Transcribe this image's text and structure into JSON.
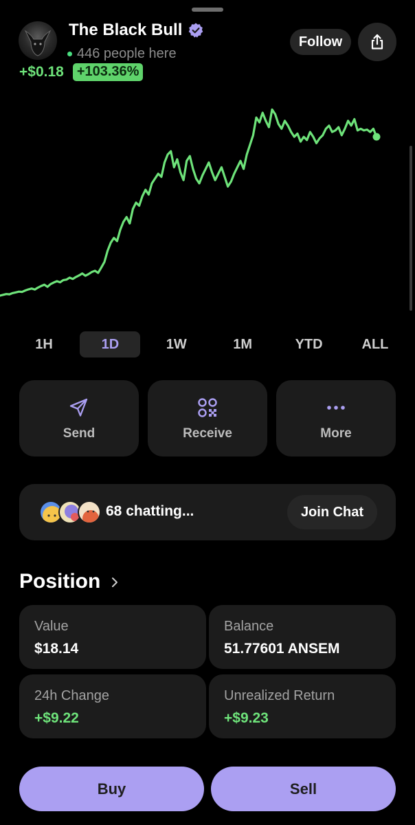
{
  "header": {
    "token_name": "The Black Bull",
    "people_here": "446 people here",
    "change_abs": "+$0.18",
    "change_pct": "+103.36%",
    "follow_label": "Follow"
  },
  "chart_data": {
    "type": "line",
    "x": [
      0,
      1,
      2,
      3,
      4,
      5,
      6,
      7,
      8,
      9,
      10,
      11,
      12,
      13,
      14,
      15,
      16,
      17,
      18,
      19,
      20,
      21,
      22,
      23,
      24,
      25,
      26,
      27,
      28,
      29,
      30,
      31,
      32,
      33,
      34,
      35,
      36,
      37,
      38,
      39,
      40,
      41,
      42,
      43,
      44,
      45,
      46,
      47,
      48,
      49,
      50,
      51,
      52,
      53,
      54,
      55,
      56,
      57,
      58,
      59,
      60,
      61,
      62,
      63,
      64,
      65,
      66,
      67,
      68,
      69,
      70,
      71,
      72,
      73,
      74,
      75,
      76,
      77,
      78,
      79,
      80,
      81,
      82,
      83,
      84,
      85,
      86,
      87,
      88,
      89,
      90,
      91,
      92,
      93,
      94,
      95,
      96,
      97,
      98,
      99,
      100,
      101,
      102,
      103,
      104,
      105,
      106,
      107,
      108,
      109,
      110,
      111,
      112,
      113,
      114,
      115,
      116,
      117,
      118,
      119
    ],
    "values": [
      0.0,
      0.5,
      1.0,
      0.8,
      1.6,
      2.0,
      2.5,
      2.3,
      3.2,
      3.9,
      4.4,
      3.8,
      5.0,
      6.0,
      6.8,
      5.5,
      7.2,
      8.2,
      9.0,
      8.3,
      9.7,
      10.0,
      11.2,
      10.4,
      11.6,
      12.6,
      13.8,
      12.4,
      13.4,
      14.7,
      15.5,
      14.2,
      17.5,
      21.0,
      28.0,
      33.0,
      36.0,
      34.0,
      41.0,
      46.0,
      49.0,
      45.0,
      54.0,
      58.0,
      56.0,
      62.0,
      66.0,
      63.0,
      70.0,
      73.0,
      76.0,
      74.0,
      83.0,
      88.0,
      90.0,
      80.0,
      85.0,
      77.0,
      72.0,
      84.0,
      87.0,
      79.0,
      73.0,
      70.0,
      75.0,
      79.0,
      83.0,
      77.0,
      72.0,
      76.0,
      80.0,
      74.0,
      68.0,
      71.0,
      76.0,
      80.0,
      84.0,
      79.0,
      88.0,
      94.0,
      100.0,
      111.0,
      108.0,
      114.0,
      109.0,
      105.0,
      116.0,
      113.0,
      107.0,
      104.0,
      109.0,
      106.0,
      102.0,
      99.0,
      101.0,
      96.0,
      99.0,
      97.0,
      102.0,
      99.0,
      95.0,
      98.0,
      100.0,
      104.0,
      106.0,
      102.0,
      103.0,
      105.0,
      100.0,
      104.0,
      109.0,
      106.0,
      110.0,
      103.0,
      104.0,
      103.0,
      103.5,
      102.0,
      104.0,
      99.0
    ],
    "ylim": [
      0,
      120
    ],
    "grid": false,
    "line_color": "#6ee37a"
  },
  "time_ranges": [
    {
      "label": "1H",
      "active": false
    },
    {
      "label": "1D",
      "active": true
    },
    {
      "label": "1W",
      "active": false
    },
    {
      "label": "1M",
      "active": false
    },
    {
      "label": "YTD",
      "active": false
    },
    {
      "label": "ALL",
      "active": false
    }
  ],
  "actions": [
    {
      "label": "Send",
      "icon": "send-icon"
    },
    {
      "label": "Receive",
      "icon": "qr-code-icon"
    },
    {
      "label": "More",
      "icon": "more-dots-icon"
    }
  ],
  "chat": {
    "count_text": "68 chatting...",
    "join_label": "Join Chat"
  },
  "position": {
    "title": "Position",
    "cards": [
      {
        "label": "Value",
        "value": "$18.14",
        "positive": false
      },
      {
        "label": "Balance",
        "value": "51.77601 ANSEM",
        "positive": false
      },
      {
        "label": "24h Change",
        "value": "+$9.22",
        "positive": true
      },
      {
        "label": "Unrealized Return",
        "value": "+$9.23",
        "positive": true
      }
    ]
  },
  "trade": {
    "buy_label": "Buy",
    "sell_label": "Sell"
  },
  "colors": {
    "accent": "#ab9ff2",
    "positive": "#6ee37a",
    "card_bg": "#1c1c1c",
    "background": "#000000"
  }
}
